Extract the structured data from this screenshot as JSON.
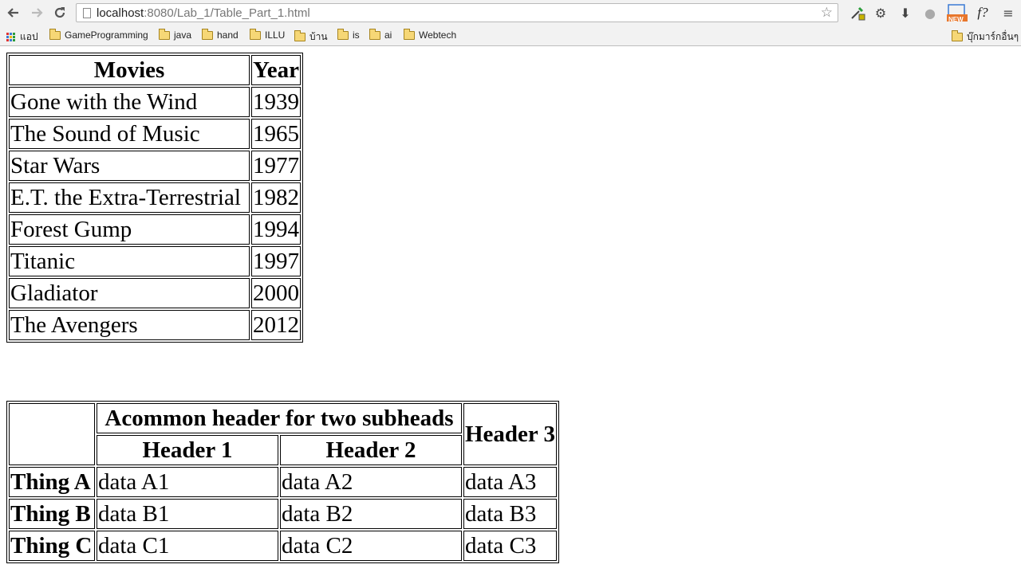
{
  "browser": {
    "url_host": "localhost",
    "url_rest": ":8080/Lab_1/Table_Part_1.html",
    "bookmarks": [
      {
        "label": "แอป",
        "type": "apps"
      },
      {
        "label": "GameProgramming",
        "type": "folder"
      },
      {
        "label": "java",
        "type": "folder"
      },
      {
        "label": "hand",
        "type": "folder"
      },
      {
        "label": "ILLU",
        "type": "folder"
      },
      {
        "label": "บ้าน",
        "type": "folder"
      },
      {
        "label": "is",
        "type": "folder"
      },
      {
        "label": "ai",
        "type": "folder"
      },
      {
        "label": "Webtech",
        "type": "folder"
      }
    ],
    "other_bookmarks": "บุ๊กมาร์กอื่นๆ",
    "ext_new_badge": "NEW",
    "ext_font_label": "f?"
  },
  "movies_table": {
    "headers": [
      "Movies",
      "Year"
    ],
    "rows": [
      [
        "Gone with the Wind",
        "1939"
      ],
      [
        "The Sound of Music",
        "1965"
      ],
      [
        "Star Wars",
        "1977"
      ],
      [
        "E.T. the Extra-Terrestrial",
        "1982"
      ],
      [
        "Forest Gump",
        "1994"
      ],
      [
        "Titanic",
        "1997"
      ],
      [
        "Gladiator",
        "2000"
      ],
      [
        "The Avengers",
        "2012"
      ]
    ]
  },
  "things_table": {
    "group_header": "Acommon header for two subheads",
    "header3": "Header 3",
    "subheaders": [
      "Header 1",
      "Header 2"
    ],
    "rows": [
      {
        "label": "Thing A",
        "cells": [
          "data A1",
          "data A2",
          "data A3"
        ]
      },
      {
        "label": "Thing B",
        "cells": [
          "data B1",
          "data B2",
          "data B3"
        ]
      },
      {
        "label": "Thing C",
        "cells": [
          "data C1",
          "data C2",
          "data C3"
        ]
      }
    ]
  }
}
